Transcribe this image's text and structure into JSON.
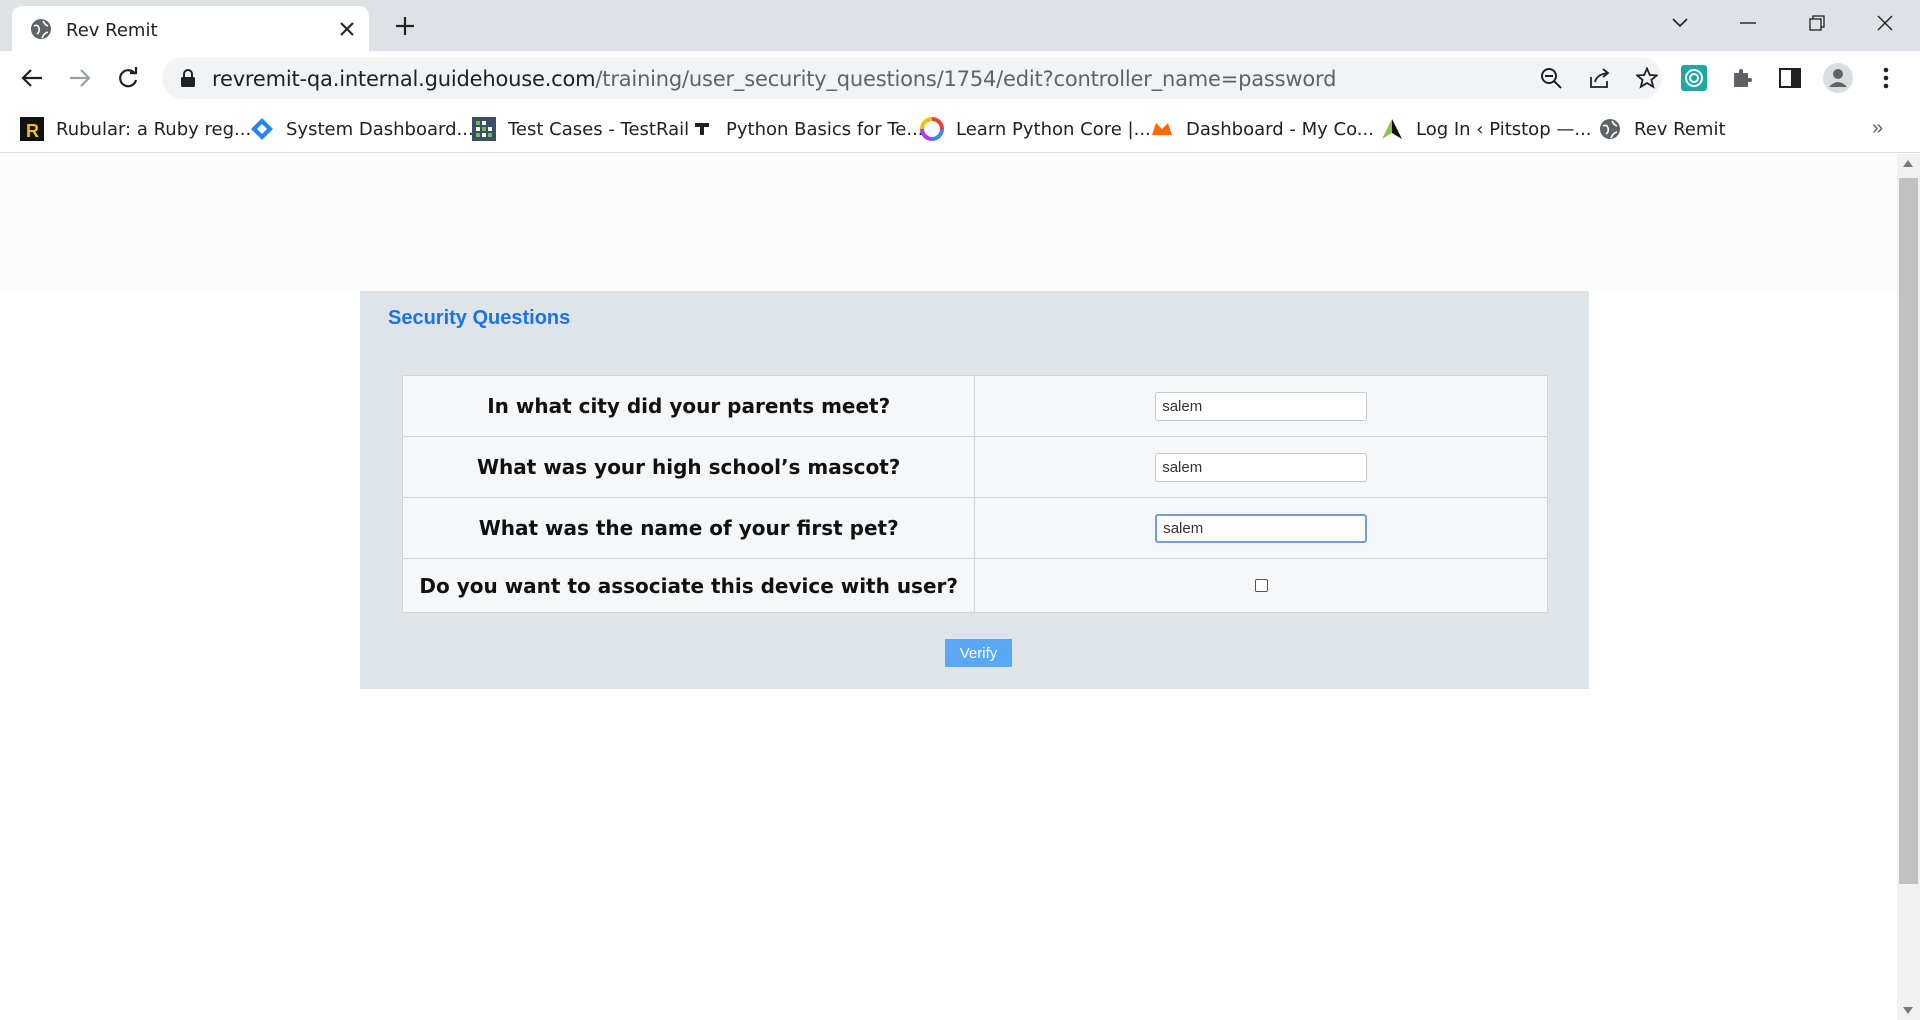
{
  "browser": {
    "tab": {
      "title": "Rev Remit",
      "favicon": "globe-icon"
    },
    "url": {
      "host": "revremit-qa.internal.guidehouse.com",
      "path": "/training/user_security_questions/1754/edit?controller_name=password"
    },
    "bookmarks": [
      {
        "label": "Rubular: a Ruby reg...",
        "icon": "rubular-icon"
      },
      {
        "label": "System Dashboard...",
        "icon": "jira-diamond-icon"
      },
      {
        "label": "Test Cases - TestRail",
        "icon": "testrail-icon"
      },
      {
        "label": "Python Basics for Te...",
        "icon": "dash-icon"
      },
      {
        "label": "Learn Python Core |...",
        "icon": "swirl-icon"
      },
      {
        "label": "Dashboard - My Co...",
        "icon": "codecademy-icon"
      },
      {
        "label": "Log In ‹ Pitstop —...",
        "icon": "pitstop-icon"
      },
      {
        "label": "Rev Remit",
        "icon": "globe-icon"
      }
    ],
    "bookmarks_more": "»",
    "accent_color": "#1a73e8"
  },
  "page": {
    "panel_title": "Security Questions",
    "questions": [
      {
        "label": "In what city did your parents meet?",
        "answer": "salem"
      },
      {
        "label": "What was your high school’s mascot?",
        "answer": "salem"
      },
      {
        "label": "What was the name of your first pet?",
        "answer": "salem"
      }
    ],
    "device_question": "Do you want to associate this device with user?",
    "device_checked": false,
    "verify_label": "Verify"
  }
}
